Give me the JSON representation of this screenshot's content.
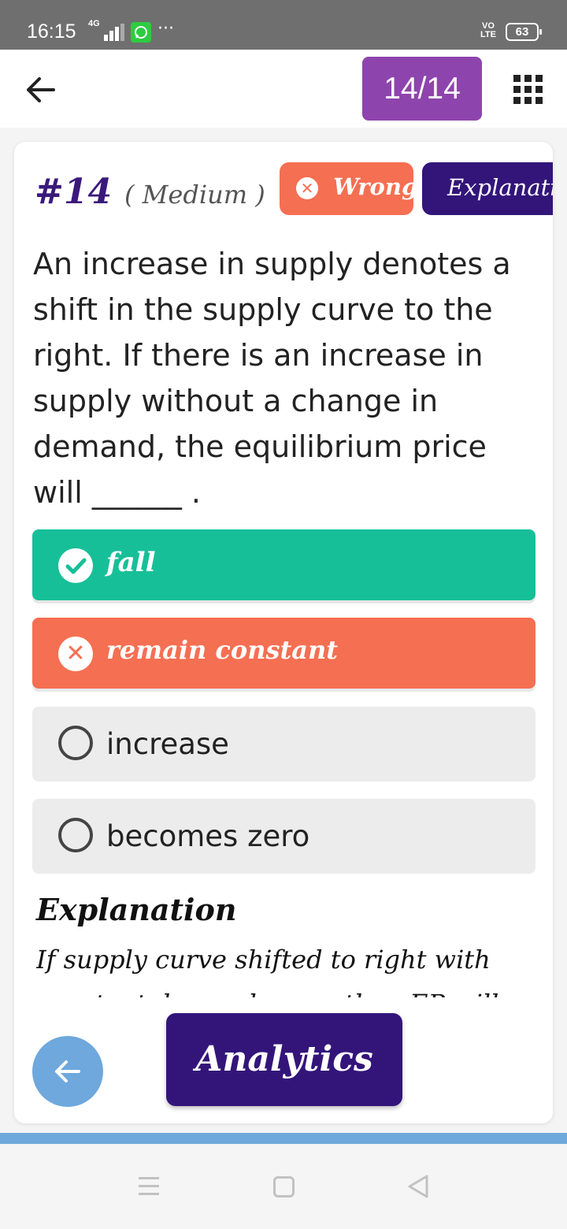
{
  "status_bar": {
    "time": "16:15",
    "network": "4G",
    "more": "···",
    "volte": "VO\nLTE",
    "battery": "63"
  },
  "header": {
    "counter": "14/14",
    "icons": [
      "back-arrow-icon",
      "grid-menu-icon"
    ]
  },
  "question": {
    "number": "#14",
    "level": "( Medium )",
    "result_label": "Wrong",
    "explanation_button": "Explanation",
    "text": "An increase in supply denotes a shift in the supply curve to the right. If there is an increase in supply without a change in demand, the equilibrium price will ______ ."
  },
  "options": [
    {
      "label": "fall",
      "state": "correct"
    },
    {
      "label": "remain constant",
      "state": "wrong"
    },
    {
      "label": "increase",
      "state": "unselected"
    },
    {
      "label": "becomes zero",
      "state": "unselected"
    }
  ],
  "explanation": {
    "title": "Explanation",
    "body": "If supply curve shifted to right with constant demand curve then EP will"
  },
  "footer": {
    "analytics_label": "Analytics"
  },
  "colors": {
    "accent_purple": "#8e44ad",
    "dark_purple": "#33157a",
    "correct_green": "#17bf98",
    "wrong_red": "#f56f52",
    "fab_blue": "#6ea8dc"
  }
}
